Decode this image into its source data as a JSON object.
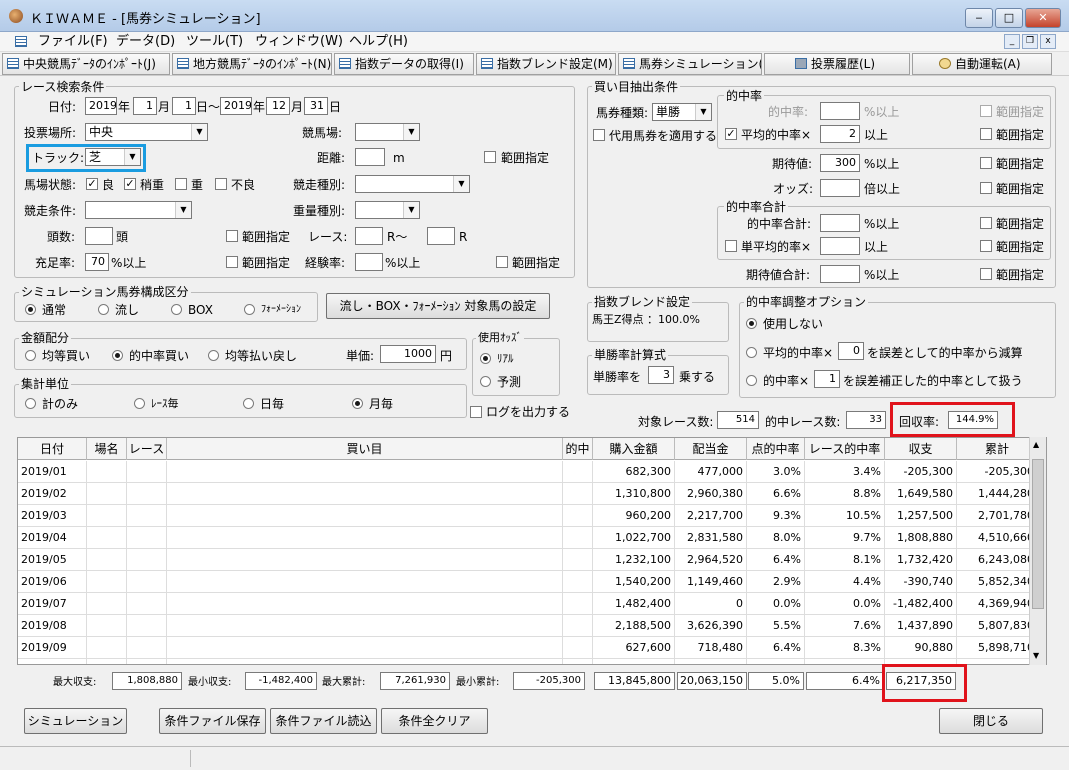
{
  "window": {
    "title": "ＫＩＷＡＭＥ - [馬券シミュレーション]",
    "min": "‒",
    "max": "□",
    "close": "✕"
  },
  "menu": [
    {
      "label": "ファイル(F)"
    },
    {
      "label": "データ(D)"
    },
    {
      "label": "ツール(T)"
    },
    {
      "label": "ウィンドウ(W)"
    },
    {
      "label": "ヘルプ(H)"
    }
  ],
  "mdi": {
    "min": "_",
    "restore": "❐",
    "close": "x"
  },
  "toolbar": [
    "中央競馬ﾃﾞｰﾀのｲﾝﾎﾟｰﾄ(J)",
    "地方競馬ﾃﾞｰﾀのｲﾝﾎﾟｰﾄ(N)",
    "指数データの取得(I)",
    "指数ブレンド設定(M)",
    "馬券シミュレーション(B)",
    "投票履歴(L)",
    "自動運転(A)"
  ],
  "race": {
    "group": "レース検索条件",
    "date_label": "日付:",
    "y1": "2019",
    "m1": "1",
    "d1": "1",
    "y2": "2019",
    "m2": "12",
    "d2": "31",
    "nen": "年",
    "tsuki": "月",
    "hi_kara": "日～",
    "hi": "日",
    "venue_label": "投票場所:",
    "venue": "中央",
    "track_label": "競馬場:",
    "track": "",
    "surface_label": "トラック:",
    "surface": "芝",
    "dist_label": "距離:",
    "dist": "",
    "dist_unit": "m",
    "range": "範囲指定",
    "cond_label": "馬場状態:",
    "good": "良",
    "slight": "稍重",
    "heavy": "重",
    "bad": "不良",
    "kind_label": "競走種別:",
    "jouken_label": "競走条件:",
    "weight_label": "重量種別:",
    "count_label": "頭数:",
    "count_unit": "頭",
    "race_label": "レース:",
    "race_from": "R～",
    "race_to": "R",
    "fill_label": "充足率:",
    "fill": "70",
    "fill_unit": "%以上",
    "exp_label": "経験率:",
    "exp_unit": "%以上"
  },
  "buy": {
    "group": "買い目抽出条件",
    "ticket_label": "馬券種類:",
    "ticket": "単勝",
    "substitute": "代用馬券を適用する",
    "hit_group": "的中率",
    "hit_label": "的中率:",
    "hit_unit": "%以上",
    "avg_label": "平均的中率×",
    "avg": "2",
    "avg_unit": "以上",
    "exp_label": "期待値:",
    "exp": "300",
    "exp_unit": "%以上",
    "odds_label": "オッズ:",
    "odds_unit": "倍以上",
    "sum_group": "的中率合計",
    "sum_label": "的中率合計:",
    "sum_unit": "%以上",
    "avg2_label": "単平均的率×",
    "avg2_unit": "以上",
    "expsum_label": "期待値合計:",
    "expsum_unit": "%以上",
    "range": "範囲指定"
  },
  "sim": {
    "group": "シミュレーション馬券構成区分",
    "opts": [
      "通常",
      "流し",
      "BOX",
      "ﾌｫｰﾒｰｼｮﾝ"
    ],
    "set_btn": "流し・BOX・ﾌｫｰﾒｰｼｮﾝ 対象馬の設定"
  },
  "blend": {
    "group": "指数ブレンド設定",
    "text": "馬王Z得点 ：100.0%"
  },
  "adj": {
    "group": "的中率調整オプション",
    "none": "使用しない",
    "opt2a": "平均的中率×",
    "opt2v": "0",
    "opt2b": "を誤差として的中率から減算",
    "opt3a": "的中率×",
    "opt3v": "1",
    "opt3b": "を誤差補正した的中率として扱う"
  },
  "money": {
    "group": "金額配分",
    "opts": [
      "均等買い",
      "的中率買い",
      "均等払い戻し"
    ],
    "unit_label": "単価:",
    "unit": "1000",
    "yen": "円"
  },
  "odds": {
    "group": "使用ｵｯｽﾞ",
    "real": "ﾘｱﾙ",
    "pred": "予測"
  },
  "win": {
    "group": "単勝率計算式",
    "pre": "単勝率を",
    "val": "3",
    "post": "乗する"
  },
  "agg": {
    "group": "集計単位",
    "opts": [
      "計のみ",
      "ﾚｰｽ毎",
      "日毎",
      "月毎"
    ],
    "log": "ログを出力する"
  },
  "summary": {
    "races_label": "対象レース数:",
    "races": "514",
    "hits_label": "的中レース数:",
    "hits": "33",
    "rec_label": "回収率:",
    "rec": "144.9%"
  },
  "grid": {
    "headers": [
      "日付",
      "場名",
      "レース",
      "買い目",
      "的中",
      "購入金額",
      "配当金",
      "点的中率",
      "レース的中率",
      "収支",
      "累計"
    ],
    "rows": [
      [
        "2019/01",
        "",
        "",
        "",
        "",
        "682,300",
        "477,000",
        "3.0%",
        "3.4%",
        "-205,300",
        "-205,300"
      ],
      [
        "2019/02",
        "",
        "",
        "",
        "",
        "1,310,800",
        "2,960,380",
        "6.6%",
        "8.8%",
        "1,649,580",
        "1,444,280"
      ],
      [
        "2019/03",
        "",
        "",
        "",
        "",
        "960,200",
        "2,217,700",
        "9.3%",
        "10.5%",
        "1,257,500",
        "2,701,780"
      ],
      [
        "2019/04",
        "",
        "",
        "",
        "",
        "1,022,700",
        "2,831,580",
        "8.0%",
        "9.7%",
        "1,808,880",
        "4,510,660"
      ],
      [
        "2019/05",
        "",
        "",
        "",
        "",
        "1,232,100",
        "2,964,520",
        "6.4%",
        "8.1%",
        "1,732,420",
        "6,243,080"
      ],
      [
        "2019/06",
        "",
        "",
        "",
        "",
        "1,540,200",
        "1,149,460",
        "2.9%",
        "4.4%",
        "-390,740",
        "5,852,340"
      ],
      [
        "2019/07",
        "",
        "",
        "",
        "",
        "1,482,400",
        "0",
        "0.0%",
        "0.0%",
        "-1,482,400",
        "4,369,940"
      ],
      [
        "2019/08",
        "",
        "",
        "",
        "",
        "2,188,500",
        "3,626,390",
        "5.5%",
        "7.6%",
        "1,437,890",
        "5,807,830"
      ],
      [
        "2019/09",
        "",
        "",
        "",
        "",
        "627,600",
        "718,480",
        "6.4%",
        "8.3%",
        "90,880",
        "5,898,710"
      ],
      [
        "2019/10",
        "",
        "",
        "",
        "",
        "1,041,300",
        "2,404,520",
        "8.8%",
        "10.5%",
        "1,363,220",
        "7,261,930"
      ]
    ]
  },
  "stats": {
    "max_label": "最大収支:",
    "max": "1,808,880",
    "min_label": "最小収支:",
    "min": "-1,482,400",
    "maxc_label": "最大累計:",
    "maxc": "7,261,930",
    "minc_label": "最小累計:",
    "minc": "-205,300",
    "buy_total": "13,845,800",
    "pay_total": "20,063,150",
    "pt_rate": "5.0%",
    "race_rate": "6.4%",
    "profit": "6,217,350"
  },
  "buttons": {
    "sim": "シミュレーション",
    "save": "条件ファイル保存",
    "load": "条件ファイル読込",
    "clear": "条件全クリア",
    "close": "閉じる"
  }
}
